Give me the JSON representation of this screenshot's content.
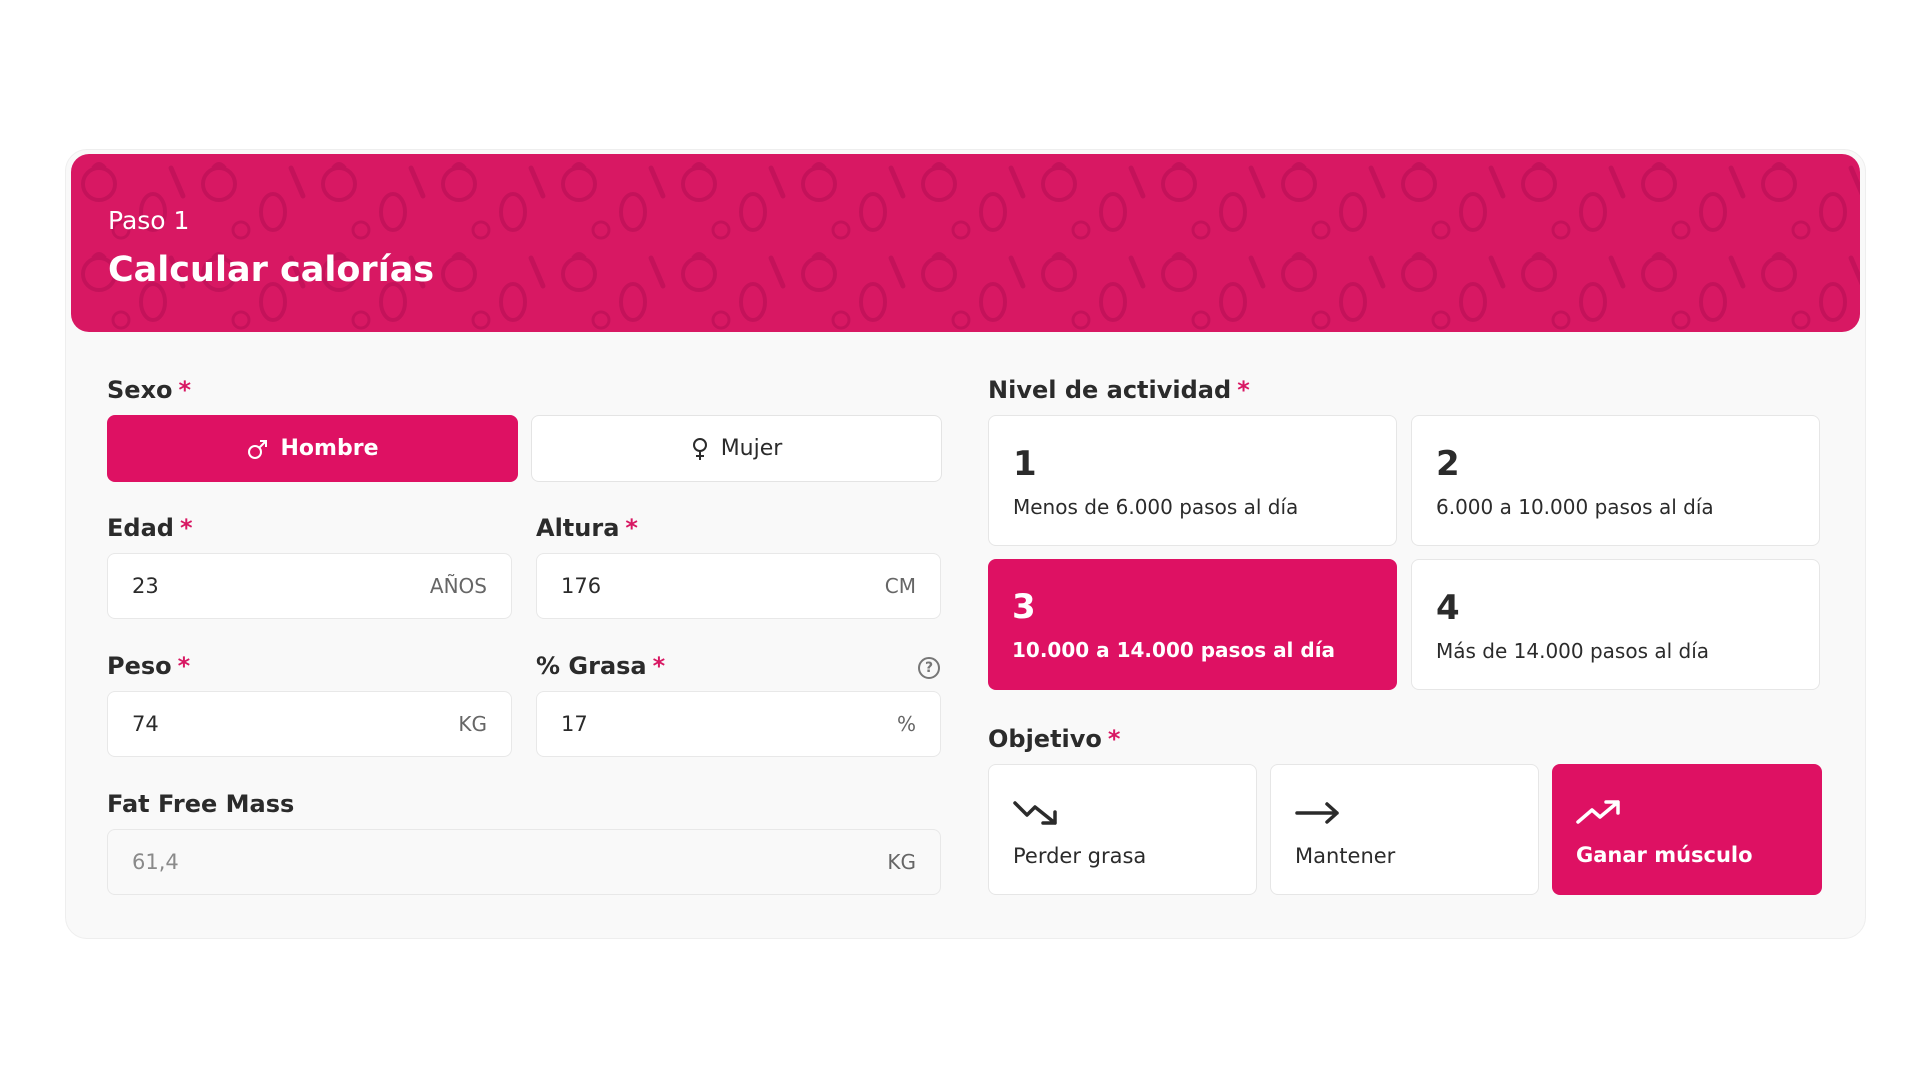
{
  "colors": {
    "accent": "#de1163",
    "banner": "#d81863",
    "required": "#d81863"
  },
  "header": {
    "step": "Paso 1",
    "title": "Calcular calorías"
  },
  "required_mark": "*",
  "sexo": {
    "label": "Sexo",
    "options": [
      {
        "label": "Hombre",
        "icon": "male-symbol-icon",
        "selected": true
      },
      {
        "label": "Mujer",
        "icon": "female-symbol-icon",
        "selected": false
      }
    ]
  },
  "edad": {
    "label": "Edad",
    "value": "23",
    "unit": "AÑOS"
  },
  "altura": {
    "label": "Altura",
    "value": "176",
    "unit": "CM"
  },
  "peso": {
    "label": "Peso",
    "value": "74",
    "unit": "KG"
  },
  "grasa": {
    "label": "% Grasa",
    "value": "17",
    "unit": "%",
    "help_icon": "question-circle-icon",
    "help_glyph": "?"
  },
  "ffm": {
    "label": "Fat Free Mass",
    "value": "61,4",
    "unit": "KG"
  },
  "actividad": {
    "label": "Nivel de actividad",
    "options": [
      {
        "num": "1",
        "desc": "Menos de 6.000 pasos al día",
        "selected": false
      },
      {
        "num": "2",
        "desc": "6.000 a 10.000 pasos al día",
        "selected": false
      },
      {
        "num": "3",
        "desc": "10.000 a 14.000 pasos al día",
        "selected": true
      },
      {
        "num": "4",
        "desc": "Más de 14.000 pasos al día",
        "selected": false
      }
    ]
  },
  "objetivo": {
    "label": "Objetivo",
    "options": [
      {
        "label": "Perder grasa",
        "icon": "trending-down-icon",
        "selected": false
      },
      {
        "label": "Mantener",
        "icon": "arrow-right-icon",
        "selected": false
      },
      {
        "label": "Ganar músculo",
        "icon": "trending-up-icon",
        "selected": true
      }
    ]
  }
}
